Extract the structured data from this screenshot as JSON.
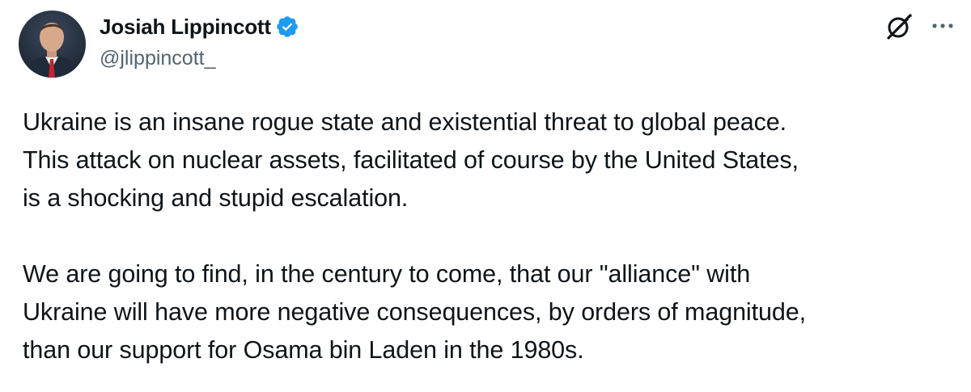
{
  "author": {
    "display_name": "Josiah Lippincott",
    "handle": "@jlippincott_",
    "verified": true
  },
  "icons": {
    "avatar": "profile-photo",
    "verified": "verified-badge-icon",
    "grok": "grok-icon",
    "more": "more-options-icon"
  },
  "colors": {
    "verified_blue": "#1d9bf0",
    "text_primary": "#0f1419",
    "text_secondary": "#536471"
  },
  "post": {
    "paragraphs": [
      {
        "lines": [
          "Ukraine is an insane rogue state and existential threat to global peace.",
          "This attack on nuclear assets, facilitated of course by the United States,",
          "is a shocking and stupid escalation."
        ]
      },
      {
        "lines": [
          "We are going to find, in the century to come, that our \"alliance\" with",
          "Ukraine will have more negative consequences, by orders of magnitude,",
          "than our support for Osama bin Laden in the 1980s."
        ]
      }
    ]
  }
}
